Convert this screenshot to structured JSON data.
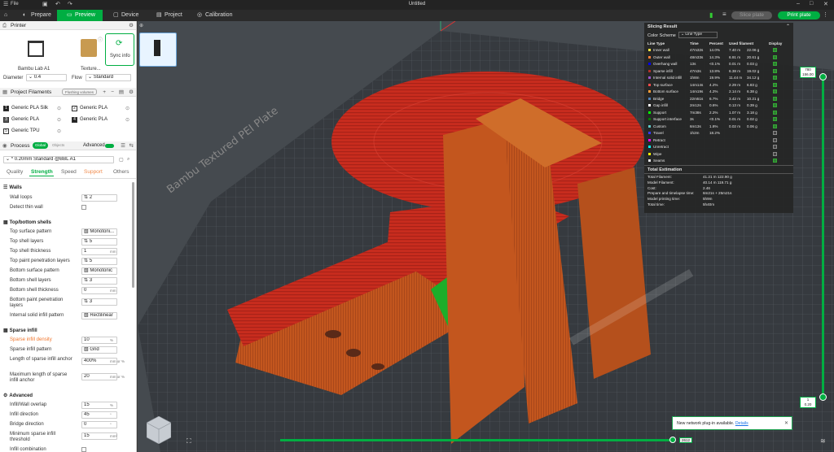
{
  "titlebar": {
    "menu": "File",
    "title": "Untitled"
  },
  "tabs": [
    {
      "label": "Prepare"
    },
    {
      "label": "Preview"
    },
    {
      "label": "Device"
    },
    {
      "label": "Project"
    },
    {
      "label": "Calibration"
    }
  ],
  "actions": {
    "slice": "Slice plate",
    "print": "Print plate"
  },
  "printer": {
    "section": "Printer",
    "name": "Bambu Lab A1",
    "texture": "Texture...",
    "sync": "Sync info",
    "diameter_label": "Diameter",
    "diameter": "0.4",
    "flow_label": "Flow",
    "flow": "Standard"
  },
  "filaments": {
    "section": "Project Filaments",
    "flushing": "Flushing volumes",
    "items": [
      {
        "num": "1",
        "name": "Generic PLA Silk",
        "color": "#222222"
      },
      {
        "num": "2",
        "name": "Generic PLA",
        "color": "#ffffff"
      },
      {
        "num": "3",
        "name": "Generic PLA",
        "color": "#555555"
      },
      {
        "num": "4",
        "name": "Generic PLA",
        "color": "#222222"
      },
      {
        "num": "5",
        "name": "Generic TPU",
        "color": "#ffffff"
      }
    ]
  },
  "process": {
    "section": "Process",
    "global": "Global",
    "objects": "Objects",
    "advanced": "Advanced",
    "preset": "* 0.20mm Standard @BBL A1",
    "tabs": [
      "Quality",
      "Strength",
      "Speed",
      "Support",
      "Others"
    ]
  },
  "settings": {
    "walls": "Walls",
    "wall_loops_label": "Wall loops",
    "wall_loops": "2",
    "detect_thin": "Detect thin wall",
    "shells": "Top/bottom shells",
    "top_pattern_label": "Top surface pattern",
    "top_pattern": "Monotoni...",
    "top_layers_label": "Top shell layers",
    "top_layers": "5",
    "top_thick_label": "Top shell thickness",
    "top_thick": "1",
    "top_paint_label": "Top paint penetration layers",
    "top_paint": "5",
    "bottom_pattern_label": "Bottom surface pattern",
    "bottom_pattern": "Monotonic",
    "bottom_layers_label": "Bottom shell layers",
    "bottom_layers": "3",
    "bottom_thick_label": "Bottom shell thickness",
    "bottom_thick": "0",
    "bottom_paint_label": "Bottom paint penetration layers",
    "bottom_paint": "3",
    "internal_solid_label": "Internal solid infill pattern",
    "internal_solid": "Rectilinear",
    "sparse": "Sparse infill",
    "density_label": "Sparse infill density",
    "density": "10",
    "pattern_label": "Sparse infill pattern",
    "pattern": "Grid",
    "anchor_label": "Length of sparse infill anchor",
    "anchor": "400%",
    "anchor_max_label": "Maximum length of sparse infill anchor",
    "anchor_max": "20",
    "advanced": "Advanced",
    "overlap_label": "Infill/Wall overlap",
    "overlap": "15",
    "direction_label": "Infill direction",
    "direction": "45",
    "bridge_dir_label": "Bridge direction",
    "bridge_dir": "0",
    "min_sparse_label": "Minimum sparse infill threshold",
    "min_sparse": "15",
    "combination_label": "Infill combination",
    "unit_mm": "mm",
    "unit_pct": "%",
    "unit_deg": "°",
    "unit_mm2": "mm²",
    "unit_mmpct": "mm or %"
  },
  "slicing": {
    "title": "Slicing Result",
    "scheme_label": "Color Scheme",
    "scheme": "Line Type",
    "cols": [
      "Line Type",
      "Time",
      "Percent",
      "Used filament",
      "Display"
    ],
    "rows": [
      {
        "name": "Inner wall",
        "time": "47m32s",
        "pct": "14.0%",
        "len": "7.40 m",
        "g": "22.06 g",
        "color": "#ffe640",
        "on": true
      },
      {
        "name": "Outer wall",
        "time": "48m33s",
        "pct": "14.3%",
        "len": "6.91 m",
        "g": "20.61 g",
        "color": "#ff7d38",
        "on": true
      },
      {
        "name": "Overhang wall",
        "time": "13s",
        "pct": "<0.1%",
        "len": "0.01 m",
        "g": "0.03 g",
        "color": "#0000ff",
        "on": true
      },
      {
        "name": "Sparse infill",
        "time": "47m3s",
        "pct": "13.8%",
        "len": "6.38 m",
        "g": "19.02 g",
        "color": "#b03029",
        "on": true
      },
      {
        "name": "Internal solid infill",
        "time": "1h8m",
        "pct": "19.9%",
        "len": "11.44 m",
        "g": "34.12 g",
        "color": "#9654cc",
        "on": true
      },
      {
        "name": "Top surface",
        "time": "14m14s",
        "pct": "4.2%",
        "len": "2.29 m",
        "g": "6.83 g",
        "color": "#f04a4a",
        "on": true
      },
      {
        "name": "Bottom surface",
        "time": "14m19s",
        "pct": "4.2%",
        "len": "2.14 m",
        "g": "6.38 g",
        "color": "#ff9e38",
        "on": true
      },
      {
        "name": "Bridge",
        "time": "22m51s",
        "pct": "6.7%",
        "len": "3.42 m",
        "g": "10.21 g",
        "color": "#4d80ba",
        "on": true
      },
      {
        "name": "Gap infill",
        "time": "2m12s",
        "pct": "0.6%",
        "len": "0.13 m",
        "g": "0.39 g",
        "color": "#ffffff",
        "on": true
      },
      {
        "name": "Support",
        "time": "7m38s",
        "pct": "2.2%",
        "len": "1.07 m",
        "g": "3.18 g",
        "color": "#00ff00",
        "on": true
      },
      {
        "name": "Support interface",
        "time": "3s",
        "pct": "<0.1%",
        "len": "0.01 m",
        "g": "0.02 g",
        "color": "#008000",
        "on": true
      },
      {
        "name": "Custom",
        "time": "6m13s",
        "pct": "1.8%",
        "len": "0.02 m",
        "g": "0.06 g",
        "color": "#5ec8c8",
        "on": true
      },
      {
        "name": "Travel",
        "time": "1h2m",
        "pct": "18.2%",
        "len": "",
        "g": "",
        "color": "#3838ff",
        "on": false
      },
      {
        "name": "Retract",
        "time": "",
        "pct": "",
        "len": "",
        "g": "",
        "color": "#ff00ff",
        "on": false
      },
      {
        "name": "Unretract",
        "time": "",
        "pct": "",
        "len": "",
        "g": "",
        "color": "#00ffff",
        "on": false
      },
      {
        "name": "Wipe",
        "time": "",
        "pct": "",
        "len": "",
        "g": "",
        "color": "#ffff00",
        "on": false
      },
      {
        "name": "Seams",
        "time": "",
        "pct": "",
        "len": "",
        "g": "",
        "color": "#e6e6e6",
        "on": true
      }
    ],
    "total_title": "Total Estimation",
    "totals": [
      {
        "k": "Total Filament:",
        "v": "41.21 m    122.90 g"
      },
      {
        "k": "Model Filament:",
        "v": "40.14 m    119.71 g"
      },
      {
        "k": "Cost:",
        "v": "2.46"
      },
      {
        "k": "Prepare and timelapse time:",
        "v": "6m21s + 25m21s"
      },
      {
        "k": "Model printing time:",
        "v": "5h9m"
      },
      {
        "k": "Total time:",
        "v": "5h40m"
      }
    ]
  },
  "vslider": {
    "top": "780",
    "top2": "156.00",
    "bottom": "1",
    "bottom2": "0.20"
  },
  "hslider": {
    "value": "2612"
  },
  "notice": {
    "text": "New network plug-in available.",
    "link": "Details"
  },
  "bed_text": "Bambu Textured PEI Plate"
}
